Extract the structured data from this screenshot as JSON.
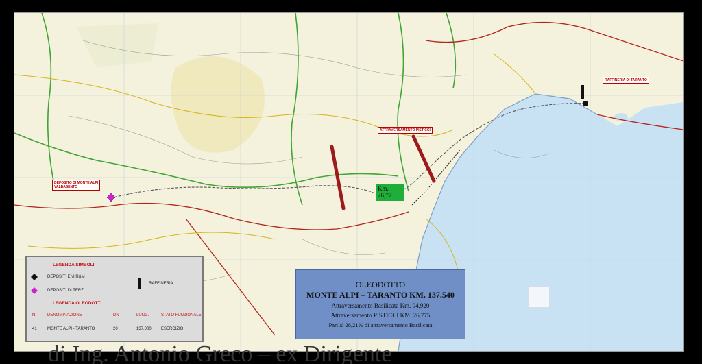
{
  "markers": {
    "depot_tecnologico": "DEPOSITO DI MONTE ALPI",
    "centro": "VALBASENTO",
    "pisticci": "ATTRAVERSAMENTO PISTICCI",
    "taranto": "RAFFINERIA DI TARANTO"
  },
  "km_label": {
    "line1": "Km.",
    "line2": "26,77"
  },
  "legend": {
    "title_symbols": "LEGENDA SIMBOLI",
    "sym_eni": "DEPOSITI ENI R&M",
    "sym_terzi": "DEPOSITI DI TERZI",
    "sym_raffineria": "RAFFINERIA",
    "title_oleodotti": "LEGENDA OLEODOTTI",
    "columns": [
      "N.",
      "DENOMINAZIONE",
      "DN",
      "LUNG.",
      "STATO FUNZIONALE"
    ],
    "row": [
      "41",
      "MONTE ALPI - TARANTO",
      "20",
      "137,000",
      "ESERCIZIO"
    ],
    "colors": {
      "eni": "#111111",
      "terzi": "#d020d0",
      "header": "#c21414"
    }
  },
  "info": {
    "title": "OLEODOTTO",
    "subtitle": "MONTE ALPI – TARANTO KM. 137.540",
    "line1": "Attraversamento Basilicata Km. 94,920",
    "line2": "Attraversamento PISTICCI KM. 26,775",
    "line3": "Pari al 28,21% di attraversamento Basilicata"
  },
  "caption": "di Ing. Antonio Greco – ex Dirigente",
  "colors": {
    "sea": "#c9e2f3",
    "land": "#f4f1dc",
    "route": "#c0392b",
    "green": "#1fae3a",
    "infobox": "#6f8fc6"
  }
}
